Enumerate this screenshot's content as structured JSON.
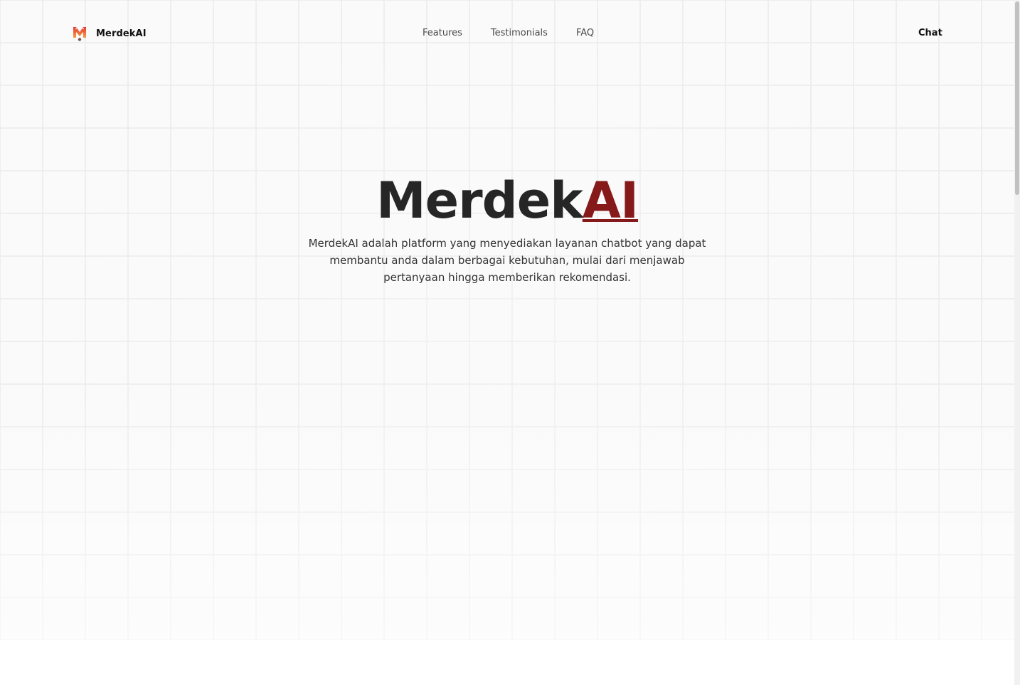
{
  "brand": {
    "name": "MerdekAI",
    "logo_icon": "merdekai-m-logo-icon",
    "colors": {
      "accent": "#861a1a",
      "logo_red": "#e53935",
      "logo_orange": "#f59e42"
    }
  },
  "nav": {
    "links": [
      {
        "label": "Features"
      },
      {
        "label": "Testimonials"
      },
      {
        "label": "FAQ"
      }
    ],
    "cta_label": "Chat"
  },
  "hero": {
    "title_main": "Merdek",
    "title_accent": "AI",
    "description": "MerdekAI adalah platform yang menyediakan layanan chatbot yang dapat membantu anda dalam berbagai kebutuhan, mulai dari menjawab pertanyaan hingga memberikan rekomendasi."
  }
}
